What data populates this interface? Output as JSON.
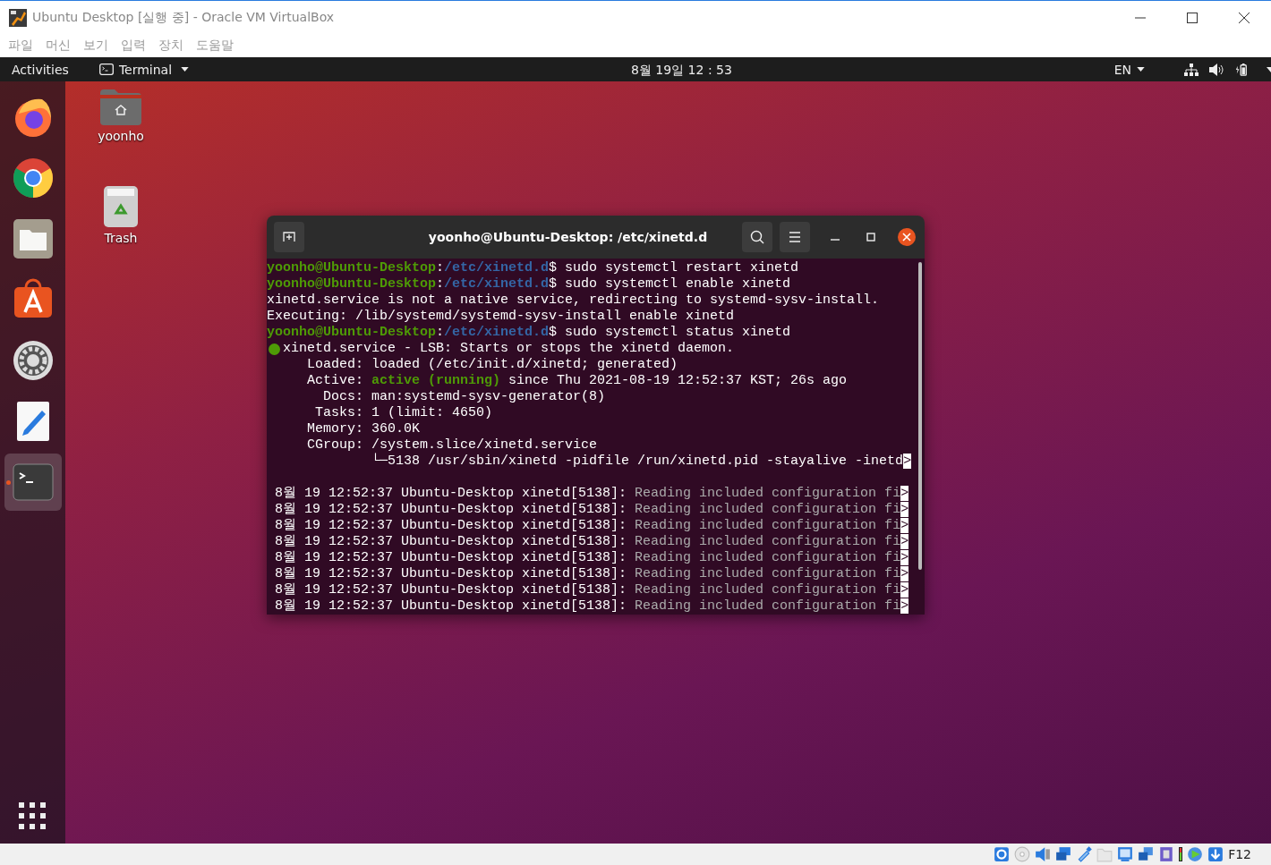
{
  "window": {
    "title": "Ubuntu Desktop [실행 중] - Oracle VM VirtualBox"
  },
  "menu": [
    "파일",
    "머신",
    "보기",
    "입력",
    "장치",
    "도움말"
  ],
  "topbar": {
    "activities": "Activities",
    "app": "Terminal",
    "clock": "8월 19일  12 : 53",
    "language": "EN"
  },
  "dock": [
    {
      "kind": "firefox",
      "selected": false,
      "running": false
    },
    {
      "kind": "chrome",
      "selected": false,
      "running": false
    },
    {
      "kind": "files",
      "selected": false,
      "running": false
    },
    {
      "kind": "software",
      "selected": false,
      "running": false
    },
    {
      "kind": "settings",
      "selected": false,
      "running": false
    },
    {
      "kind": "editor",
      "selected": false,
      "running": false
    },
    {
      "kind": "terminal",
      "selected": true,
      "running": true
    }
  ],
  "desktop_icons": [
    {
      "kind": "home",
      "label": "yoonho"
    },
    {
      "kind": "trash",
      "label": "Trash"
    }
  ],
  "terminal": {
    "title": "yoonho@Ubuntu-Desktop: /etc/xinetd.d",
    "lines": [
      {
        "kind": "text",
        "segments": [
          {
            "kind": "user",
            "text": "yoonho@Ubuntu-Desktop"
          },
          {
            "kind": "plain",
            "text": ":"
          },
          {
            "kind": "path",
            "text": "/etc/xinetd.d"
          },
          {
            "kind": "plain",
            "text": "$ sudo systemctl restart xinetd"
          }
        ]
      },
      {
        "kind": "text",
        "segments": [
          {
            "kind": "user",
            "text": "yoonho@Ubuntu-Desktop"
          },
          {
            "kind": "plain",
            "text": ":"
          },
          {
            "kind": "path",
            "text": "/etc/xinetd.d"
          },
          {
            "kind": "plain",
            "text": "$ sudo systemctl enable xinetd"
          }
        ]
      },
      {
        "kind": "text",
        "segments": [
          {
            "kind": "plain",
            "text": "xinetd.service is not a native service, redirecting to systemd-sysv-install."
          }
        ]
      },
      {
        "kind": "text",
        "segments": [
          {
            "kind": "plain",
            "text": "Executing: /lib/systemd/systemd-sysv-install enable xinetd"
          }
        ]
      },
      {
        "kind": "text",
        "segments": [
          {
            "kind": "user",
            "text": "yoonho@Ubuntu-Desktop"
          },
          {
            "kind": "plain",
            "text": ":"
          },
          {
            "kind": "path",
            "text": "/etc/xinetd.d"
          },
          {
            "kind": "plain",
            "text": "$ sudo systemctl status xinetd"
          }
        ]
      },
      {
        "kind": "status",
        "color": "#4e9a06",
        "segments": [
          {
            "kind": "plain",
            "text": "xinetd.service - LSB: Starts or stops the xinetd daemon."
          }
        ]
      },
      {
        "kind": "text",
        "segments": [
          {
            "kind": "plain",
            "text": "     Loaded: loaded (/etc/init.d/xinetd; generated)"
          }
        ]
      },
      {
        "kind": "text",
        "segments": [
          {
            "kind": "plain",
            "text": "     Active: "
          },
          {
            "kind": "ok",
            "text": "active (running)"
          },
          {
            "kind": "plain",
            "text": " since Thu 2021-08-19 12:52:37 KST; 26s ago"
          }
        ]
      },
      {
        "kind": "text",
        "segments": [
          {
            "kind": "plain",
            "text": "       Docs: man:systemd-sysv-generator(8)"
          }
        ]
      },
      {
        "kind": "text",
        "segments": [
          {
            "kind": "plain",
            "text": "      Tasks: 1 (limit: 4650)"
          }
        ]
      },
      {
        "kind": "text",
        "segments": [
          {
            "kind": "plain",
            "text": "     Memory: 360.0K"
          }
        ]
      },
      {
        "kind": "text",
        "segments": [
          {
            "kind": "plain",
            "text": "     CGroup: /system.slice/xinetd.service"
          }
        ]
      },
      {
        "kind": "text",
        "segments": [
          {
            "kind": "plain",
            "text": "             └─5138 /usr/sbin/xinetd -pidfile /run/xinetd.pid -stayalive -inetd"
          },
          {
            "kind": "cut",
            "text": ">"
          }
        ]
      },
      {
        "kind": "blank"
      },
      {
        "kind": "text",
        "segments": [
          {
            "kind": "plain",
            "text": " 8월 19 12:52:37 Ubuntu-Desktop xinetd[5138]: "
          },
          {
            "kind": "dim",
            "text": "Reading included configuration fi"
          },
          {
            "kind": "cut",
            "text": ">"
          }
        ]
      },
      {
        "kind": "text",
        "segments": [
          {
            "kind": "plain",
            "text": " 8월 19 12:52:37 Ubuntu-Desktop xinetd[5138]: "
          },
          {
            "kind": "dim",
            "text": "Reading included configuration fi"
          },
          {
            "kind": "cut",
            "text": ">"
          }
        ]
      },
      {
        "kind": "text",
        "segments": [
          {
            "kind": "plain",
            "text": " 8월 19 12:52:37 Ubuntu-Desktop xinetd[5138]: "
          },
          {
            "kind": "dim",
            "text": "Reading included configuration fi"
          },
          {
            "kind": "cut",
            "text": ">"
          }
        ]
      },
      {
        "kind": "text",
        "segments": [
          {
            "kind": "plain",
            "text": " 8월 19 12:52:37 Ubuntu-Desktop xinetd[5138]: "
          },
          {
            "kind": "dim",
            "text": "Reading included configuration fi"
          },
          {
            "kind": "cut",
            "text": ">"
          }
        ]
      },
      {
        "kind": "text",
        "segments": [
          {
            "kind": "plain",
            "text": " 8월 19 12:52:37 Ubuntu-Desktop xinetd[5138]: "
          },
          {
            "kind": "dim",
            "text": "Reading included configuration fi"
          },
          {
            "kind": "cut",
            "text": ">"
          }
        ]
      },
      {
        "kind": "text",
        "segments": [
          {
            "kind": "plain",
            "text": " 8월 19 12:52:37 Ubuntu-Desktop xinetd[5138]: "
          },
          {
            "kind": "dim",
            "text": "Reading included configuration fi"
          },
          {
            "kind": "cut",
            "text": ">"
          }
        ]
      },
      {
        "kind": "text",
        "segments": [
          {
            "kind": "plain",
            "text": " 8월 19 12:52:37 Ubuntu-Desktop xinetd[5138]: "
          },
          {
            "kind": "dim",
            "text": "Reading included configuration fi"
          },
          {
            "kind": "cut",
            "text": ">"
          }
        ]
      },
      {
        "kind": "text",
        "segments": [
          {
            "kind": "plain",
            "text": " 8월 19 12:52:37 Ubuntu-Desktop xinetd[5138]: "
          },
          {
            "kind": "dim",
            "text": "Reading included configuration fi"
          },
          {
            "kind": "cut",
            "text": ">"
          }
        ]
      }
    ]
  },
  "status_bar": {
    "host_key": "F12"
  }
}
